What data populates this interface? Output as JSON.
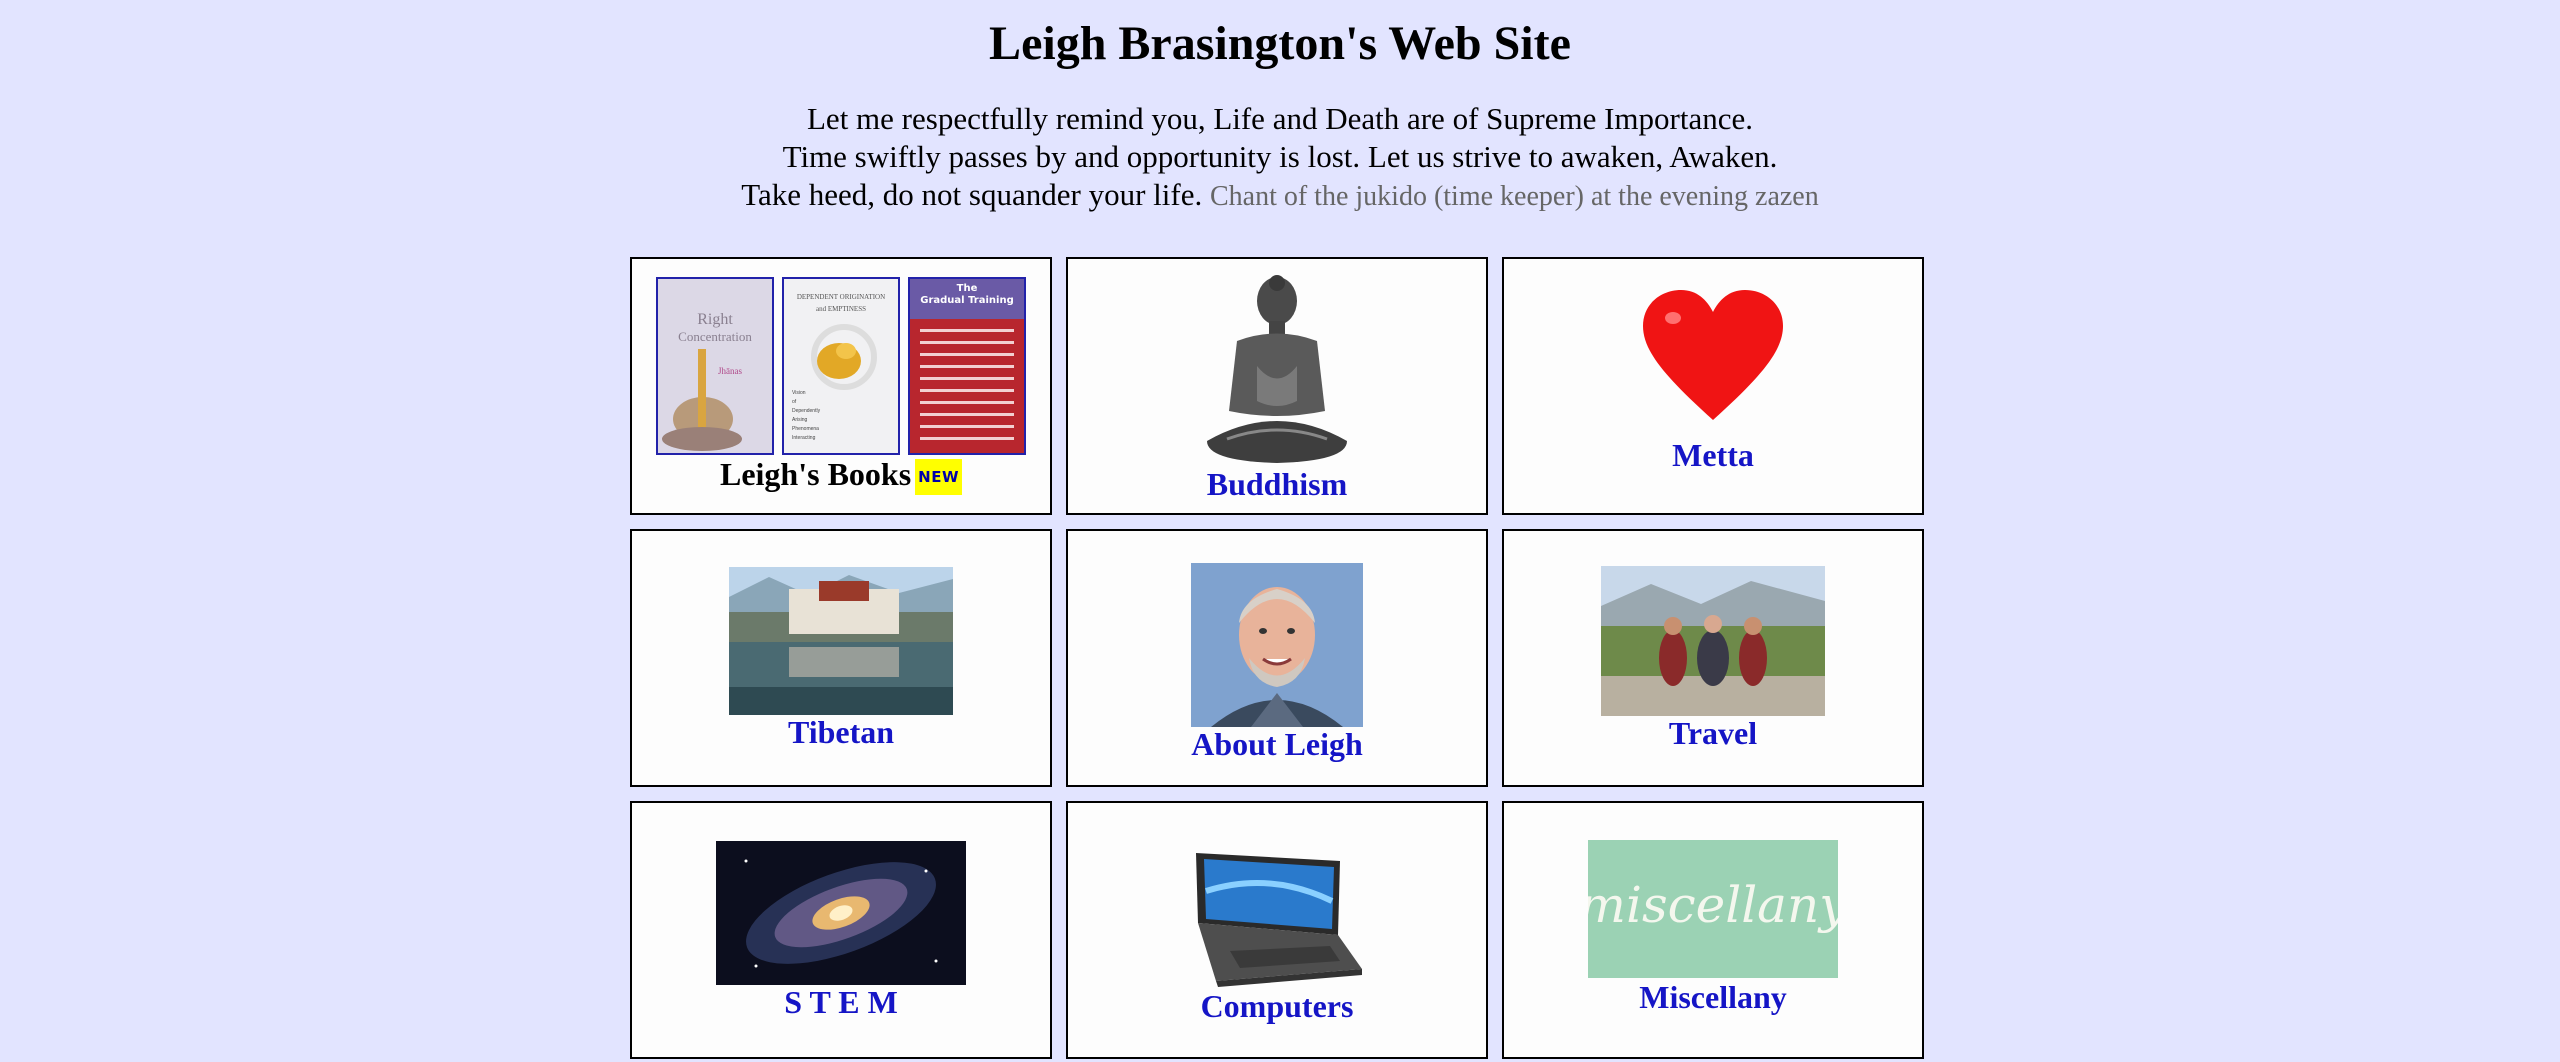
{
  "page": {
    "title": "Leigh Brasington's Web Site",
    "poem_lines": [
      "Let me respectfully remind you, Life and Death are of Supreme Importance.",
      "Time swiftly passes by and opportunity is lost. Let us strive to awaken, Awaken.",
      "Take heed, do not squander your life."
    ],
    "attribution": "Chant of the jukido (time keeper) at the evening zazen"
  },
  "tiles": [
    {
      "label": "Leigh's Books",
      "badge": "NEW",
      "icon": "books-icon"
    },
    {
      "label": "Buddhism",
      "icon": "buddha-statue-icon"
    },
    {
      "label": "Metta",
      "icon": "heart-icon"
    },
    {
      "label": "Tibetan",
      "icon": "potala-palace-icon"
    },
    {
      "label": "About Leigh",
      "icon": "portrait-icon"
    },
    {
      "label": "Travel",
      "icon": "travel-photo-icon"
    },
    {
      "label": "S T E M",
      "icon": "galaxy-icon"
    },
    {
      "label": "Computers",
      "icon": "laptop-icon"
    },
    {
      "label": "Miscellany",
      "icon": "miscellany-logo-icon"
    }
  ],
  "book_covers": {
    "book1_title": "Right Concentration",
    "book2_title": "DEPENDENT ORIGINATION and EMPTINESS",
    "book3_title": "The Gradual Training"
  },
  "miscellany_logo_text": "miscellany",
  "colors": {
    "background": "#e2e4ff",
    "link": "#1515c6",
    "badge": "#ffff00"
  }
}
